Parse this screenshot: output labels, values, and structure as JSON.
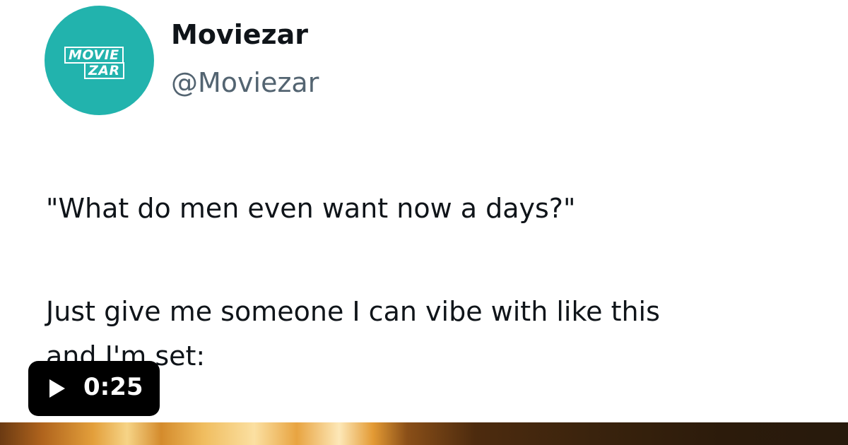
{
  "account": {
    "name": "Moviezar",
    "handle": "@Moviezar",
    "avatar_color": "#22b3ad",
    "logo_line1": "MOVIE",
    "logo_line2": "ZAR"
  },
  "tweet": {
    "line1": "\"What do men even want now a days?\"",
    "line2": "Just give me someone I can vibe with like this",
    "line3": "and I'm set:"
  },
  "video": {
    "duration": "0:25",
    "play_icon": "play-icon"
  }
}
